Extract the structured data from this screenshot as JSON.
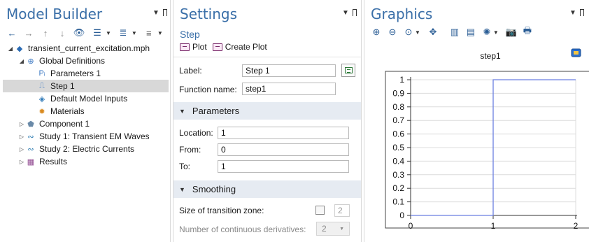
{
  "model_builder": {
    "title": "Model Builder",
    "tree": [
      {
        "label": "transient_current_excitation.mph",
        "icon": "model-icon",
        "level": 0,
        "twist": "▲"
      },
      {
        "label": "Global Definitions",
        "icon": "globe-icon",
        "level": 1,
        "twist": "▲"
      },
      {
        "label": "Parameters 1",
        "icon": "parameters-icon",
        "level": 2,
        "twist": ""
      },
      {
        "label": "Step 1",
        "icon": "step-function-icon",
        "level": 2,
        "twist": "",
        "selected": true
      },
      {
        "label": "Default Model Inputs",
        "icon": "model-inputs-icon",
        "level": 2,
        "twist": ""
      },
      {
        "label": "Materials",
        "icon": "materials-icon",
        "level": 2,
        "twist": ""
      },
      {
        "label": "Component 1",
        "icon": "component-icon",
        "level": 1,
        "twist": "▶"
      },
      {
        "label": "Study 1: Transient EM Waves",
        "icon": "study-icon",
        "level": 1,
        "twist": "▶"
      },
      {
        "label": "Study 2: Electric Currents",
        "icon": "study-icon",
        "level": 1,
        "twist": "▶"
      },
      {
        "label": "Results",
        "icon": "results-icon",
        "level": 1,
        "twist": "▶"
      }
    ]
  },
  "settings": {
    "title": "Settings",
    "subtitle": "Step",
    "plot_label": "Plot",
    "create_plot_label": "Create Plot",
    "label_field": {
      "label": "Label:",
      "value": "Step 1"
    },
    "function_name": {
      "label": "Function name:",
      "value": "step1"
    },
    "parameters_section": "Parameters",
    "location": {
      "label": "Location:",
      "value": "1"
    },
    "from": {
      "label": "From:",
      "value": "0"
    },
    "to": {
      "label": "To:",
      "value": "1"
    },
    "smoothing_section": "Smoothing",
    "transition_zone": {
      "label": "Size of transition zone:",
      "value": "2"
    },
    "derivatives": {
      "label": "Number of continuous derivatives:",
      "value": "2"
    }
  },
  "graphics": {
    "title": "Graphics"
  },
  "chart_data": {
    "type": "line",
    "title": "step1",
    "x": [
      0,
      1,
      1,
      2
    ],
    "series": [
      {
        "values": [
          0,
          0,
          1,
          1
        ]
      }
    ],
    "xlim": [
      0,
      2
    ],
    "ylim": [
      0,
      1
    ],
    "xticks": [
      "0",
      "1",
      "2"
    ],
    "yticks": [
      "0",
      "0.1",
      "0.2",
      "0.3",
      "0.4",
      "0.5",
      "0.6",
      "0.7",
      "0.8",
      "0.9",
      "1"
    ],
    "grid": true,
    "line_color": "#6b7fe0"
  },
  "colors": {
    "title_blue": "#3a6fa8",
    "section_bg": "#e6ebf2",
    "selected_row": "#d8d8d8"
  }
}
